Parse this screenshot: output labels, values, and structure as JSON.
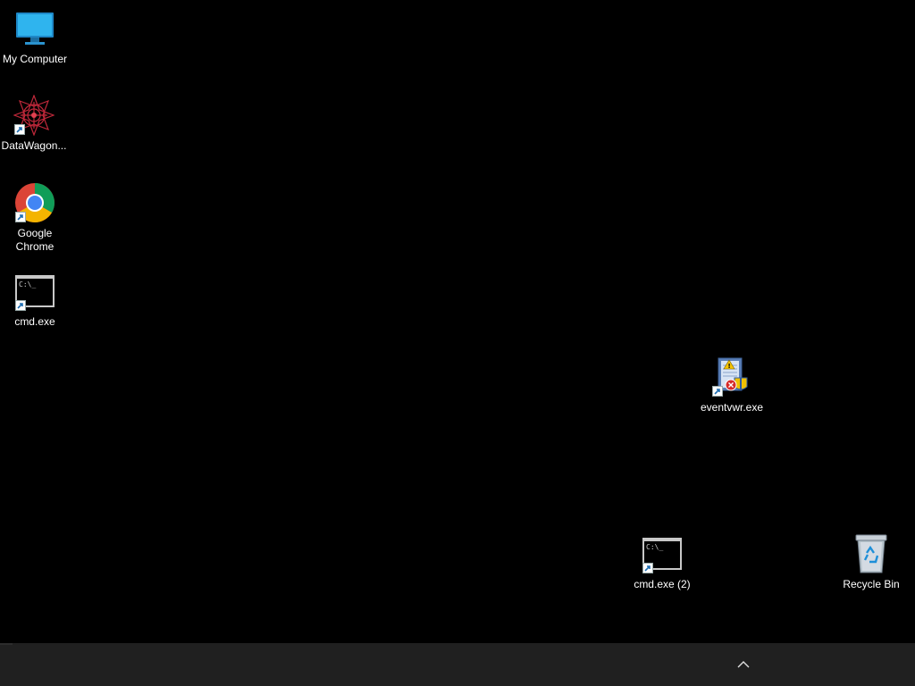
{
  "desktop": {
    "icons": {
      "my_computer": {
        "label": "My Computer",
        "icon": "monitor-icon"
      },
      "datawagon": {
        "label": "DataWagon...",
        "icon": "datawagon-icon",
        "shortcut": true
      },
      "chrome": {
        "label": "Google Chrome",
        "icon": "chrome-icon",
        "shortcut": true
      },
      "cmd": {
        "label": "cmd.exe",
        "icon": "terminal-icon",
        "shortcut": true
      },
      "eventvwr": {
        "label": "eventvwr.exe",
        "icon": "event-viewer-icon",
        "shortcut": true
      },
      "cmd2": {
        "label": "cmd.exe (2)",
        "icon": "terminal-icon",
        "shortcut": true
      },
      "recycle_bin": {
        "label": "Recycle Bin",
        "icon": "recycle-bin-icon"
      }
    },
    "background_color": "#000000"
  },
  "taskbar": {
    "color": "#202020",
    "tray_chevron_icon": "chevron-up-icon"
  }
}
